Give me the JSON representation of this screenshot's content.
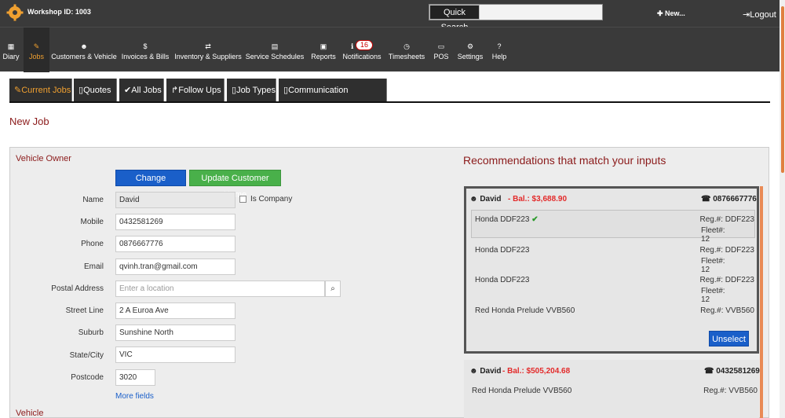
{
  "topbar": {
    "workshop_label": "Workshop ID: 1003",
    "quick_search_label": "Quick Search",
    "quick_search_value": "",
    "new_label": "✚ New...",
    "logout_label": "⇥Logout"
  },
  "nav": {
    "items": [
      {
        "label": "Diary",
        "icon": "calendar-icon",
        "glyph": "▦"
      },
      {
        "label": "Jobs",
        "icon": "wrench-icon",
        "glyph": "✎",
        "active": true
      },
      {
        "label": "Customers & Vehicle",
        "icon": "users-icon",
        "glyph": "☻"
      },
      {
        "label": "Invoices & Bills",
        "icon": "dollar-icon",
        "glyph": "$"
      },
      {
        "label": "Inventory & Suppliers",
        "icon": "exchange-icon",
        "glyph": "⇄"
      },
      {
        "label": "Service Schedules",
        "icon": "calendar-small-icon",
        "glyph": "▤"
      },
      {
        "label": "Reports",
        "icon": "picture-icon",
        "glyph": "▣"
      },
      {
        "label": "Notifications",
        "icon": "info-icon",
        "glyph": "ℹ",
        "badge": "16"
      },
      {
        "label": "Timesheets",
        "icon": "clock-icon",
        "glyph": "◷"
      },
      {
        "label": "POS",
        "icon": "pos-icon",
        "glyph": "▭"
      },
      {
        "label": "Settings",
        "icon": "gear-icon",
        "glyph": "⚙"
      },
      {
        "label": "Help",
        "icon": "question-icon",
        "glyph": "?"
      }
    ]
  },
  "tabs": [
    {
      "label": "Current Jobs",
      "glyph": "✎",
      "active": true
    },
    {
      "label": "Quotes",
      "glyph": "▯"
    },
    {
      "label": "All Jobs",
      "glyph": "✔"
    },
    {
      "label": "Follow Ups",
      "glyph": "↱"
    },
    {
      "label": "Job Types",
      "glyph": "▯"
    },
    {
      "label": "Communication Templates",
      "glyph": "▯"
    }
  ],
  "page": {
    "title": "New Job"
  },
  "owner": {
    "section_title": "Vehicle Owner",
    "change_customer": "Change Customer",
    "update_customer_name": "Update Customer Name",
    "is_company_label": "Is Company",
    "fields": {
      "name": {
        "label": "Name",
        "value": "David"
      },
      "mobile": {
        "label": "Mobile",
        "value": "0432581269"
      },
      "phone": {
        "label": "Phone",
        "value": "0876667776"
      },
      "email": {
        "label": "Email",
        "value": "qvinh.tran@gmail.com"
      },
      "postal": {
        "label": "Postal Address",
        "placeholder": "Enter a location"
      },
      "street": {
        "label": "Street Line",
        "value": "2 A Euroa Ave"
      },
      "suburb": {
        "label": "Suburb",
        "value": "Sunshine North"
      },
      "state": {
        "label": "State/City",
        "value": "VIC"
      },
      "postcode": {
        "label": "Postcode",
        "value": "3020"
      }
    },
    "more_fields": "More fields",
    "vehicle_section": "Vehicle"
  },
  "recommendations": {
    "title": "Recommendations that match your inputs",
    "cards": [
      {
        "name": "David",
        "balance": "- Bal.: $3,688.90",
        "phone": "0876667776",
        "vehicles": [
          {
            "name": "Honda DDF223",
            "reg": "Reg.#: DDF223",
            "fleet": "Fleet#: 12",
            "selected": true
          },
          {
            "name": "Honda DDF223",
            "reg": "Reg.#: DDF223",
            "fleet": "Fleet#: 12"
          },
          {
            "name": "Honda DDF223",
            "reg": "Reg.#: DDF223",
            "fleet": "Fleet#: 12"
          },
          {
            "name": "Red Honda Prelude VVB560",
            "reg": "Reg.#: VVB560",
            "fleet": ""
          }
        ],
        "unselect_label": "Unselect"
      },
      {
        "name": "David",
        "balance": "- Bal.: $505,204.68",
        "phone": "0432581269",
        "vehicles": [
          {
            "name": "Red Honda Prelude VVB560",
            "reg": "Reg.#: VVB560"
          }
        ]
      }
    ]
  },
  "colors": {
    "accent": "#f0a030",
    "dark_bar": "#3a3a3a",
    "title_red": "#8b1a1a",
    "balance_red": "#e32a2a",
    "primary_blue": "#1a5fc9",
    "success_green": "#49b04a"
  }
}
